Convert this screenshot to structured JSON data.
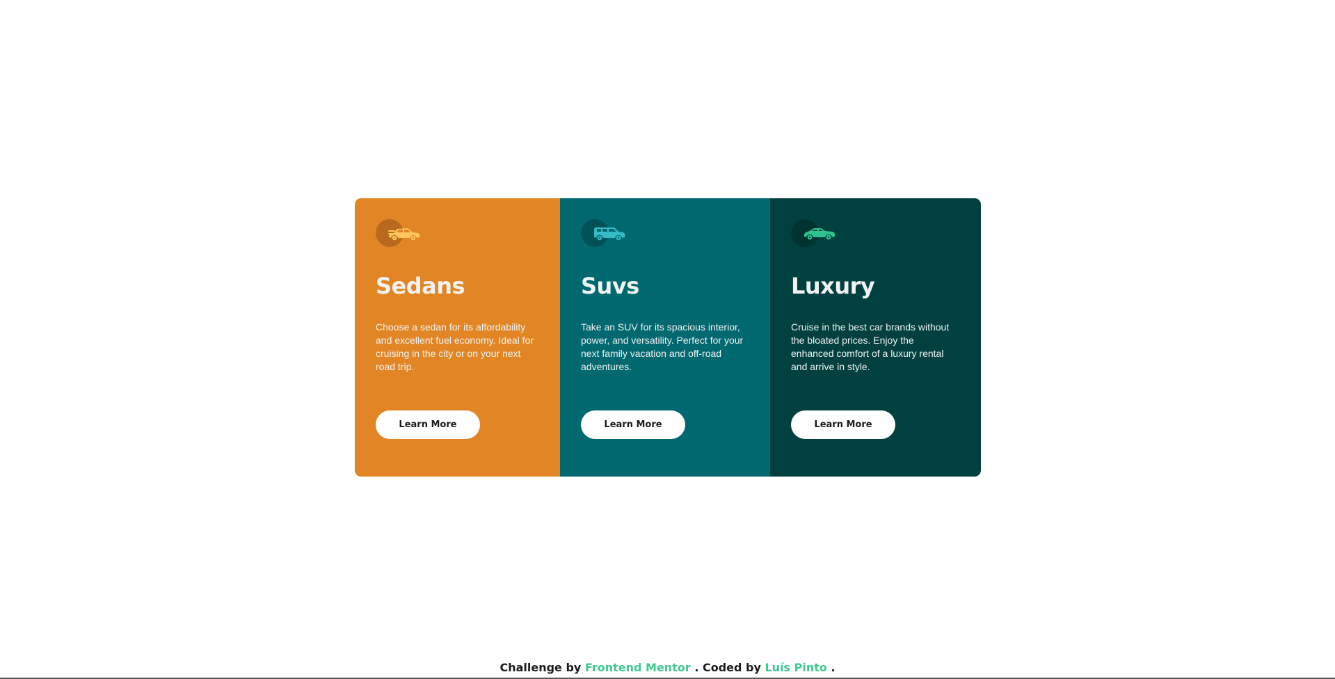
{
  "cards": [
    {
      "icon": "sedan-car-icon",
      "title": "Sedans",
      "description": "Choose a sedan for its affordability and excellent fuel economy. Ideal for cruising in the city or on your next road trip.",
      "button_label": "Learn More",
      "bg_color": "#e28625",
      "icon_color": "#ffc75b"
    },
    {
      "icon": "suv-car-icon",
      "title": "Suvs",
      "description": "Take an SUV for its spacious interior, power, and versatility. Perfect for your next family vacation and off-road adventures.",
      "button_label": "Learn More",
      "bg_color": "#006970",
      "icon_color": "#35bac6"
    },
    {
      "icon": "luxury-car-icon",
      "title": "Luxury",
      "description": "Cruise in the best car brands without the bloated prices. Enjoy the enhanced comfort of a luxury rental and arrive in style.",
      "button_label": "Learn More",
      "bg_color": "#004140",
      "icon_color": "#2ec48f"
    }
  ],
  "footer": {
    "prefix": "Challenge by",
    "challenge_link": "Frontend Mentor",
    "middle": ". Coded by",
    "author_link": "Luís Pinto",
    "suffix": "."
  },
  "colors": {
    "link": "#3fc98d",
    "button_bg": "#ffffff",
    "page_bg": "#ffffff"
  }
}
